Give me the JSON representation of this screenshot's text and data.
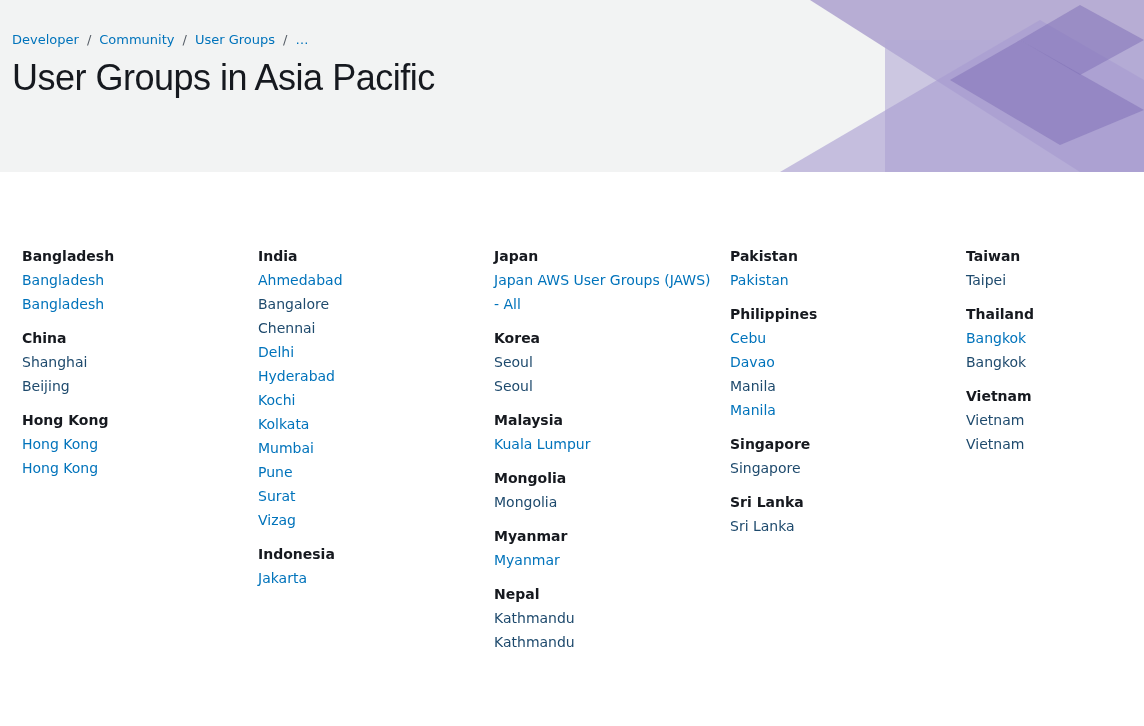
{
  "breadcrumb": [
    "Developer",
    "Community",
    "User Groups",
    "…"
  ],
  "breadcrumb_separator": "/",
  "title": "User Groups in Asia Pacific",
  "columns": [
    {
      "groups": [
        {
          "country": "Bangladesh",
          "links": [
            {
              "label": "Bangladesh",
              "visited": false
            },
            {
              "label": "Bangladesh",
              "visited": false
            }
          ]
        },
        {
          "country": "China",
          "links": [
            {
              "label": "Shanghai",
              "visited": true
            },
            {
              "label": "Beijing",
              "visited": true
            }
          ]
        },
        {
          "country": "Hong Kong",
          "links": [
            {
              "label": "Hong Kong",
              "visited": false
            },
            {
              "label": "Hong Kong",
              "visited": false
            }
          ]
        }
      ]
    },
    {
      "groups": [
        {
          "country": "India",
          "links": [
            {
              "label": "Ahmedabad",
              "visited": false
            },
            {
              "label": "Bangalore",
              "visited": true
            },
            {
              "label": "Chennai",
              "visited": true
            },
            {
              "label": "Delhi",
              "visited": false
            },
            {
              "label": "Hyderabad",
              "visited": false
            },
            {
              "label": "Kochi",
              "visited": false
            },
            {
              "label": "Kolkata",
              "visited": false
            },
            {
              "label": "Mumbai",
              "visited": false
            },
            {
              "label": "Pune",
              "visited": false
            },
            {
              "label": "Surat",
              "visited": false
            },
            {
              "label": "Vizag",
              "visited": false
            }
          ]
        },
        {
          "country": "Indonesia",
          "links": [
            {
              "label": "Jakarta",
              "visited": false
            }
          ]
        }
      ]
    },
    {
      "groups": [
        {
          "country": "Japan",
          "links": [
            {
              "label": "Japan AWS User Groups (JAWS) - All",
              "visited": false
            }
          ]
        },
        {
          "country": "Korea",
          "links": [
            {
              "label": "Seoul",
              "visited": true
            },
            {
              "label": "Seoul",
              "visited": true
            }
          ]
        },
        {
          "country": "Malaysia",
          "links": [
            {
              "label": "Kuala Lumpur",
              "visited": false
            }
          ]
        },
        {
          "country": "Mongolia",
          "links": [
            {
              "label": "Mongolia",
              "visited": true
            }
          ]
        },
        {
          "country": "Myanmar",
          "links": [
            {
              "label": "Myanmar",
              "visited": false
            }
          ]
        },
        {
          "country": "Nepal",
          "links": [
            {
              "label": "Kathmandu",
              "visited": true
            },
            {
              "label": "Kathmandu",
              "visited": true
            }
          ]
        }
      ]
    },
    {
      "groups": [
        {
          "country": "Pakistan",
          "links": [
            {
              "label": "Pakistan",
              "visited": false
            }
          ]
        },
        {
          "country": "Philippines",
          "links": [
            {
              "label": "Cebu",
              "visited": false
            },
            {
              "label": "Davao",
              "visited": false
            },
            {
              "label": "Manila",
              "visited": true
            },
            {
              "label": "Manila",
              "visited": false
            }
          ]
        },
        {
          "country": "Singapore",
          "links": [
            {
              "label": "Singapore",
              "visited": true
            }
          ]
        },
        {
          "country": "Sri Lanka",
          "links": [
            {
              "label": "Sri Lanka",
              "visited": true
            }
          ]
        }
      ]
    },
    {
      "groups": [
        {
          "country": "Taiwan",
          "links": [
            {
              "label": "Taipei",
              "visited": true
            }
          ]
        },
        {
          "country": "Thailand",
          "links": [
            {
              "label": "Bangkok",
              "visited": false
            },
            {
              "label": "Bangkok",
              "visited": true
            }
          ]
        },
        {
          "country": "Vietnam",
          "links": [
            {
              "label": "Vietnam",
              "visited": true
            },
            {
              "label": "Vietnam",
              "visited": true
            }
          ]
        }
      ]
    }
  ]
}
